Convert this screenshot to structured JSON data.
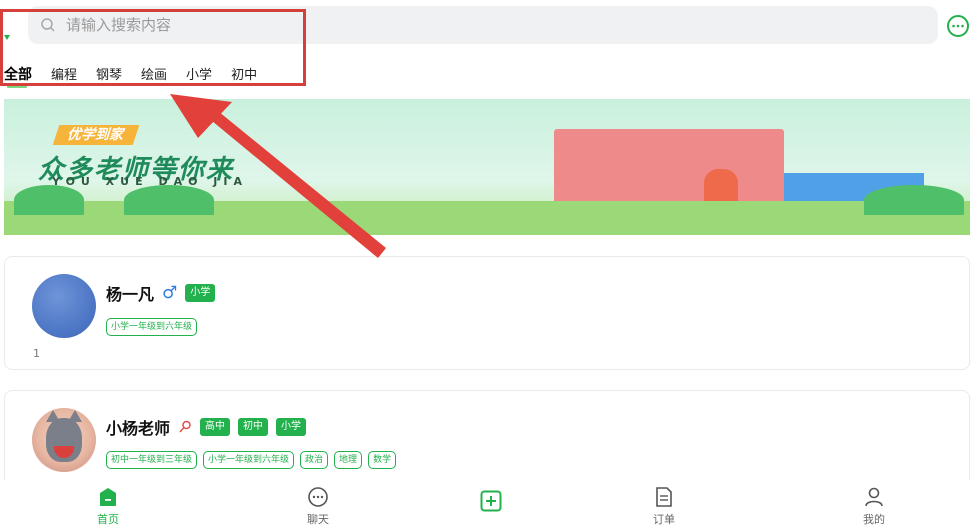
{
  "search": {
    "placeholder": "请输入搜索内容"
  },
  "tabs": [
    {
      "label": "全部",
      "active": true
    },
    {
      "label": "编程",
      "active": false
    },
    {
      "label": "钢琴",
      "active": false
    },
    {
      "label": "绘画",
      "active": false
    },
    {
      "label": "小学",
      "active": false
    },
    {
      "label": "初中",
      "active": false
    }
  ],
  "banner": {
    "tag": "优学到家",
    "slogan": "众多老师等你来",
    "pinyin": "YOU XUE DAO JIA"
  },
  "teachers": [
    {
      "name": "杨一凡",
      "gender_symbol": "♂",
      "badges": [
        "小学"
      ],
      "chips": [
        "小学一年级到六年级"
      ],
      "count": "1"
    },
    {
      "name": "小杨老师",
      "badges": [
        "高中",
        "初中",
        "小学"
      ],
      "chips": [
        "初中一年级到三年级",
        "小学一年级到六年级",
        "政治",
        "地理",
        "数学"
      ]
    }
  ],
  "nav": {
    "home": "首页",
    "chat": "聊天",
    "order": "订单",
    "mine": "我的"
  },
  "colors": {
    "brand_green": "#22b14c",
    "highlight_red": "#d6403a",
    "gender_blue": "#2a7de1"
  },
  "icons": [
    "search-icon",
    "chat-bubble-icon",
    "gender-male-icon",
    "pin-icon",
    "home-icon",
    "chat-icon",
    "add-icon",
    "order-icon",
    "profile-icon"
  ]
}
